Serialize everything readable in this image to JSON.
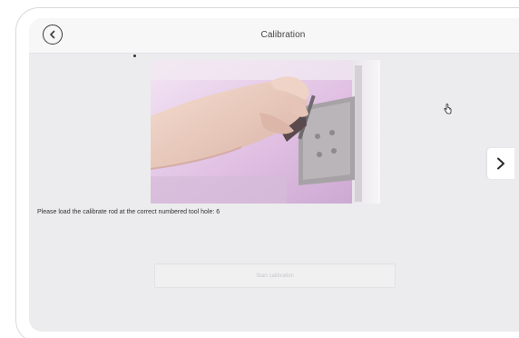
{
  "header": {
    "title": "Calibration",
    "back_icon": "back-arrow-icon"
  },
  "media": {
    "kind": "video-frame"
  },
  "main": {
    "instruction": "Please load the calibrate rod at the correct numbered tool hole: 6",
    "start_button_label": "Start calibration",
    "start_button_state": "disabled"
  },
  "navigation": {
    "next_icon": "chevron-right-icon"
  },
  "colors": {
    "screen_bg": "#ececee",
    "titlebar_bg": "#f7f7f8",
    "video_tint": "#d9c3dc",
    "button_text": "#c8c8cc"
  }
}
